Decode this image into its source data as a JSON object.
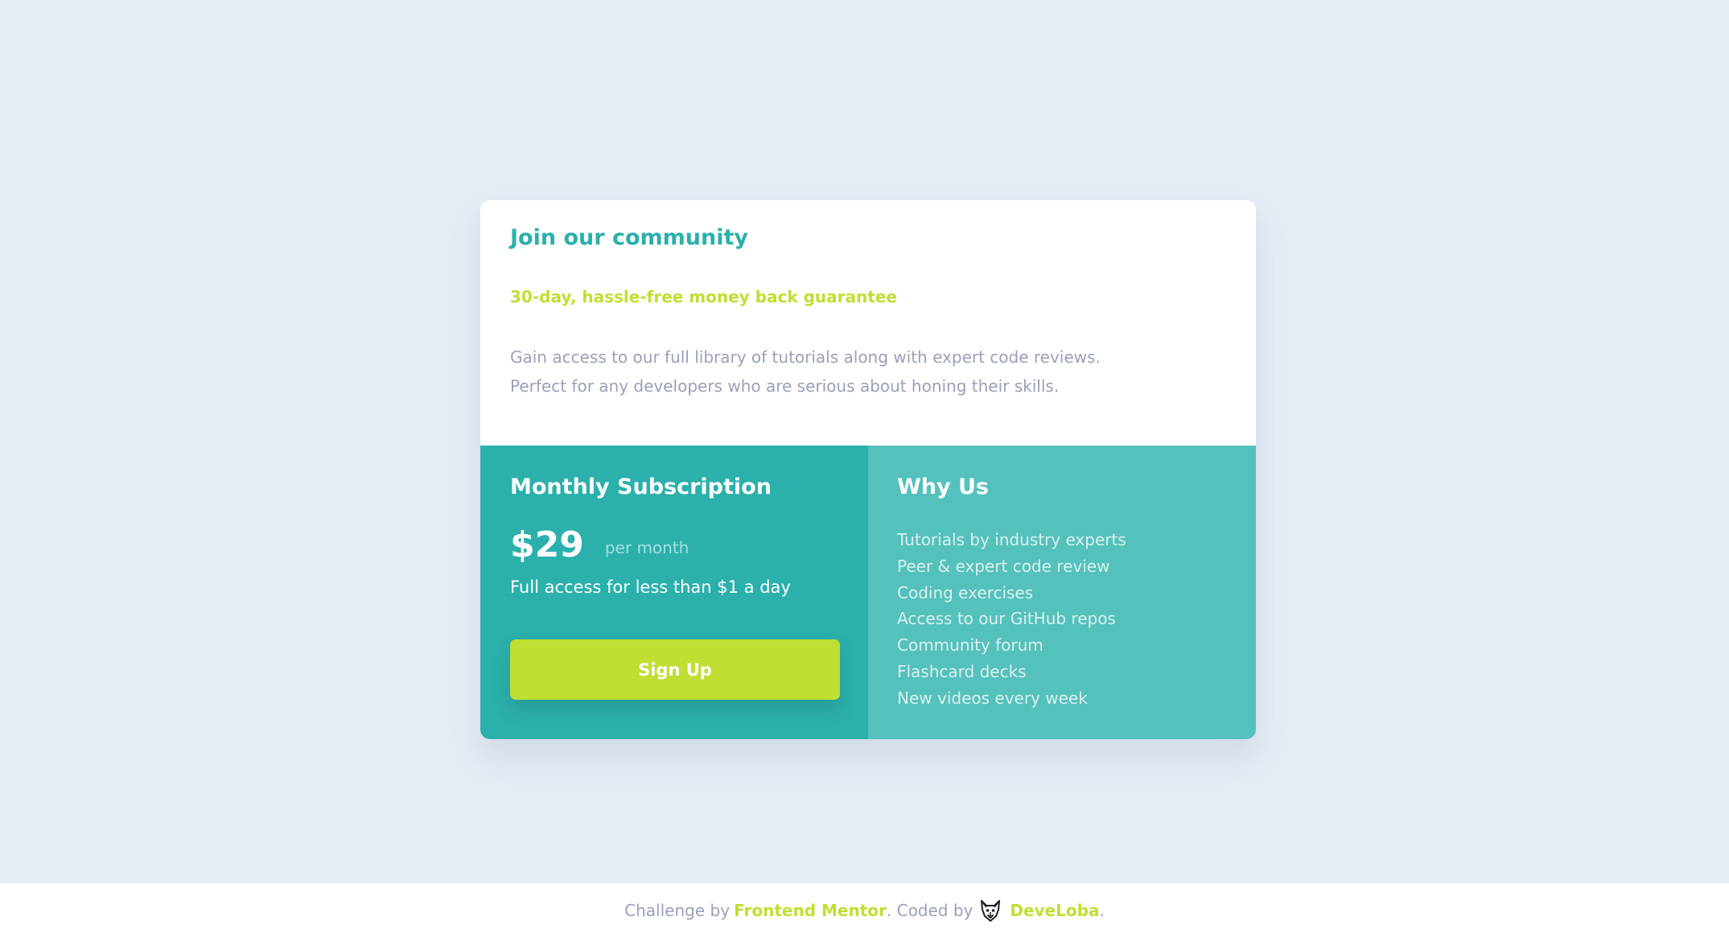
{
  "card": {
    "title": "Join our community",
    "guarantee": "30-day, hassle-free money back guarantee",
    "description_line1": "Gain access to our full library of tutorials along with expert code reviews.",
    "description_line2": "Perfect for any developers who are serious about honing their skills."
  },
  "subscription": {
    "title": "Monthly Subscription",
    "price": "$29",
    "period": "per month",
    "access": "Full access for less than $1 a day",
    "button_label": "Sign Up"
  },
  "why_us": {
    "title": "Why Us",
    "items": [
      "Tutorials by industry experts",
      "Peer & expert code review",
      "Coding exercises",
      "Access to our GitHub repos",
      "Community forum",
      "Flashcard decks",
      "New videos every week"
    ]
  },
  "footer": {
    "challenge_prefix": "Challenge by",
    "challenge_link": "Frontend Mentor",
    "coded_prefix": ". Coded by",
    "author_icon": "wolf-icon",
    "author_link": "DeveLoba",
    "suffix": "."
  },
  "colors": {
    "background": "#e5ecf4",
    "primary_teal": "#2bb0ac",
    "light_teal": "#55c1bd",
    "lime": "#bfdf32",
    "grey_text": "#9aa0bb"
  }
}
